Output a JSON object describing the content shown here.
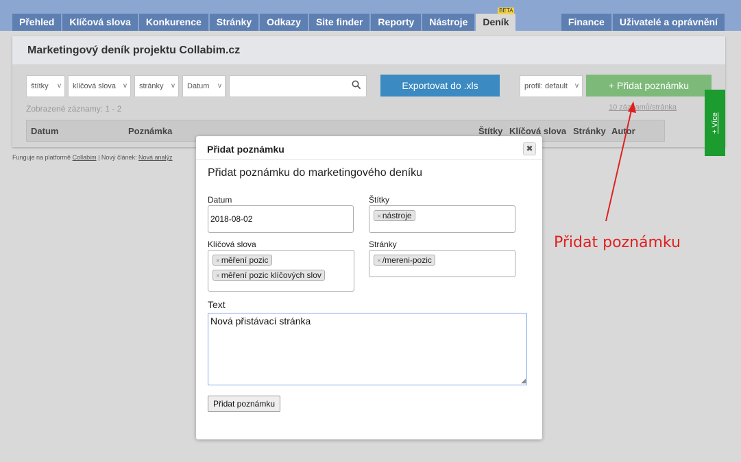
{
  "nav": {
    "tabs": [
      "Přehled",
      "Klíčová slova",
      "Konkurence",
      "Stránky",
      "Odkazy",
      "Site finder",
      "Reporty",
      "Nástroje"
    ],
    "active_tab": "Deník",
    "active_badge": "BETA",
    "right_tabs": [
      "Finance",
      "Uživatelé a oprávnění"
    ]
  },
  "panel": {
    "title": "Marketingový deník projektu Collabim.cz",
    "filters": {
      "tags": "štítky",
      "keywords": "klíčová slova",
      "pages": "stránky",
      "date": "Datum"
    },
    "search_icon": "search-icon",
    "export_label": "Exportovat do .xls",
    "profile_label": "profil: default",
    "add_note_label": "+ Přidat poznámku",
    "shown_count": "Zobrazené záznamy: 1 - 2",
    "per_page": "10 záznamů/stránka",
    "columns": {
      "date": "Datum",
      "note": "Poznámka",
      "tags": "Štítky",
      "keywords": "Klíčová slova",
      "pages": "Stránky",
      "author": "Autor"
    }
  },
  "footer": {
    "text_prefix": "Funguje na platformě",
    "link_platform": "Collabim",
    "text_mid": " | Nový článek:",
    "link_article": "Nová analýz"
  },
  "side_tab": {
    "label": "+ Více"
  },
  "annotation": {
    "text": "Přidat poznámku",
    "color": "#e02020"
  },
  "modal": {
    "title": "Přidat poznámku",
    "close_icon": "close-icon",
    "subtitle": "Přidat poznámku do marketingového deníku",
    "date_label": "Datum",
    "date_value": "2018-08-02",
    "tags_label": "Štítky",
    "tags": [
      "nástroje"
    ],
    "keywords_label": "Klíčová slova",
    "keywords": [
      "měření pozic",
      "měření pozic klíčových slov"
    ],
    "pages_label": "Stránky",
    "pages": [
      "/mereni-pozic"
    ],
    "text_label": "Text",
    "text_value": "Nová přistávací stránka",
    "submit_label": "Přidat poznámku"
  }
}
